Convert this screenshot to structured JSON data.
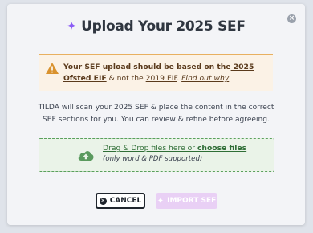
{
  "modal": {
    "close_glyph": "×",
    "title": "Upload Your 2025 SEF",
    "sparkle_glyph": "✦"
  },
  "warning": {
    "text_a": "Your SEF upload should be based on the",
    "link_a": " 2025 Ofsted EIF",
    "text_b": " & not the ",
    "link_b": "2019 EIF",
    "text_c": ". ",
    "link_c": "Find out why"
  },
  "description": "TILDA will scan your 2025 SEF & place the content in the correct SEF sections for you. You can review & refine before agreeing.",
  "dropzone": {
    "text": "Drag & Drop files here or ",
    "link": "choose files",
    "note": "(only word & PDF supported)"
  },
  "buttons": {
    "cancel_icon": "✕",
    "cancel": "CANCEL",
    "import_icon": "✦",
    "import": "IMPORT SEF"
  },
  "colors": {
    "accent": "#8b5cf6",
    "warning": "#e8b060",
    "dropzone": "#5aa05c",
    "import_disabled": "#e9d0f5"
  }
}
